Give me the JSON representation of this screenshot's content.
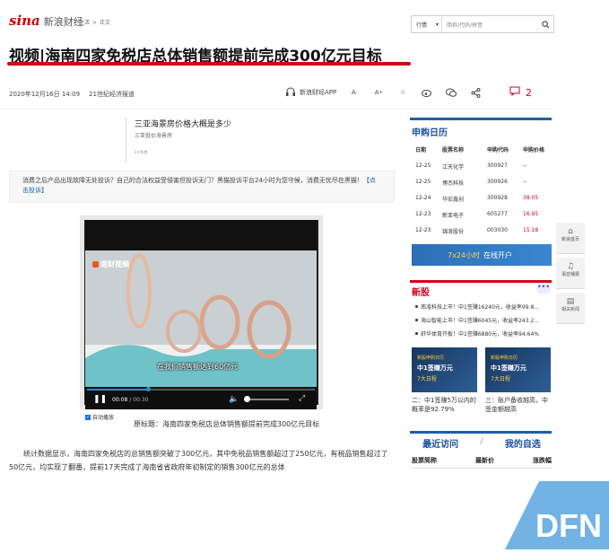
{
  "header": {
    "logo_main": "sina",
    "logo_sub": "新浪财经",
    "breadcrumb": [
      "生活",
      ">",
      "正文"
    ],
    "search_select": "行情",
    "search_placeholder": "简称/代码/拼音"
  },
  "article": {
    "title": "视频|海南四家免税店总体销售额提前完成300亿元目标",
    "date": "2020年12月16日 14:09",
    "source": "21世纪经济报道",
    "app_label": "新浪财经APP",
    "comment_count": "2",
    "ad_title": "三亚海景房价格大概是多少",
    "ad_subtitle": "三亚低价海景房",
    "ad_tag": "2月免费",
    "notice_text": "消费之后产品出现故障无处投诉？自己的合法权益受侵害但投诉无门？黑猫投诉平台24小时为您守候，消费无忧尽在黑猫！",
    "notice_link": "【点击投诉】",
    "video_brand": "南财视频",
    "video_caption": "在我们销售额达到60亿元",
    "video_time_current": "00:08",
    "video_time_sep": "/",
    "video_time_total": "00:30",
    "autoplay_label": "自动播放",
    "video_original_title": "原标题：海南四家免税店总体销售额提前完成300亿元目标",
    "paragraph": "统计数据显示，海南四家免税店的总销售额突破了300亿元，其中免税品销售额超过了250亿元，有税品销售超过了50亿元，均实现了翻番，提前17天完成了海南省省政府年初制定的销售300亿元的总体"
  },
  "ipo_calendar": {
    "title": "申购日历",
    "headers": [
      "日期",
      "股票名称",
      "申购代码",
      "申购价格"
    ],
    "rows": [
      [
        "12-25",
        "江天化学",
        "300927",
        "--"
      ],
      [
        "12-25",
        "博杰科技",
        "300926",
        "--"
      ],
      [
        "12-24",
        "华宏鑫创",
        "300928",
        "38.05"
      ],
      [
        "12-23",
        "新亚电子",
        "605277",
        "16.95"
      ],
      [
        "12-23",
        "锦浪股份",
        "003030",
        "15.18"
      ]
    ]
  },
  "banner": {
    "highlight": "7x24小时",
    "text": "在线开户"
  },
  "new_stocks": {
    "title": "新股",
    "items": [
      "南凌科技上市！中1签赚16240元，收益率99.8…",
      "海山智能上市！中1签赚6045元，收益率243.2…",
      "舒华体育开板！中1签赚6880元，收益率94.64%"
    ],
    "thumbs": [
      {
        "line1": "新股申购日历",
        "line2": "中1签赚万元",
        "line3": "7大日程"
      },
      {
        "line1": "新股申购日历",
        "line2": "中1签赚万元",
        "line3": "7大日程"
      }
    ],
    "captions": [
      "二：中1签赚5万以内的概率是92.79%",
      "三：账户备收越高，中签金额越高"
    ]
  },
  "recent_tabs": {
    "tab1": "最近访问",
    "sep": "/",
    "tab2": "我的自选",
    "cols": [
      "股票简称",
      "最新价",
      "涨跌幅"
    ]
  },
  "side_float": [
    "新浪首页",
    "语音播报",
    "相关新闻"
  ]
}
